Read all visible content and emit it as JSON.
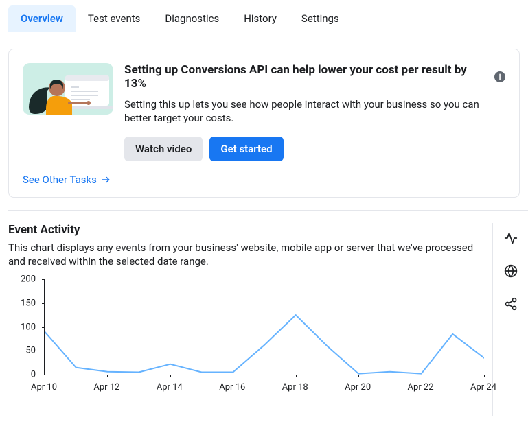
{
  "tabs": [
    {
      "label": "Overview",
      "active": true
    },
    {
      "label": "Test events",
      "active": false
    },
    {
      "label": "Diagnostics",
      "active": false
    },
    {
      "label": "History",
      "active": false
    },
    {
      "label": "Settings",
      "active": false
    }
  ],
  "promo": {
    "title": "Setting up Conversions API can help lower your cost per result by 13%",
    "description": "Setting this up lets you see how people interact with your business so you can better target your costs.",
    "watch_video_label": "Watch video",
    "get_started_label": "Get started",
    "see_other_label": "See Other Tasks"
  },
  "event_activity": {
    "title": "Event Activity",
    "description": "This chart displays any events from your business' website, mobile app or server that we've processed and received within the selected date range."
  },
  "chart_data": {
    "type": "line",
    "x": [
      "Apr 10",
      "Apr 11",
      "Apr 12",
      "Apr 13",
      "Apr 14",
      "Apr 15",
      "Apr 16",
      "Apr 17",
      "Apr 18",
      "Apr 19",
      "Apr 20",
      "Apr 21",
      "Apr 22",
      "Apr 23",
      "Apr 24"
    ],
    "values": [
      90,
      15,
      6,
      5,
      22,
      5,
      5,
      62,
      125,
      60,
      2,
      6,
      2,
      85,
      35
    ],
    "x_tick_labels": [
      "Apr 10",
      "Apr 12",
      "Apr 14",
      "Apr 16",
      "Apr 18",
      "Apr 20",
      "Apr 22",
      "Apr 24"
    ],
    "y_tick_labels": [
      "0",
      "50",
      "100",
      "150",
      "200"
    ],
    "ylim": [
      0,
      200
    ],
    "line_color": "#66b3ff"
  }
}
